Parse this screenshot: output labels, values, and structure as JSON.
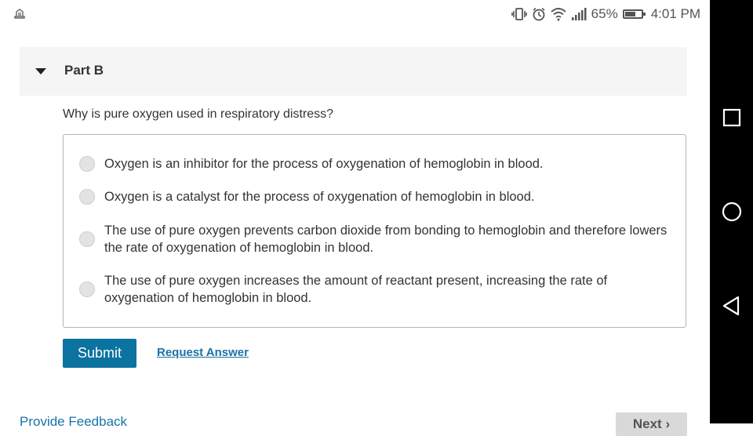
{
  "status_bar": {
    "battery_percent": "65%",
    "battery_level": 0.65,
    "time": "4:01 PM",
    "icons": [
      "vibrate-icon",
      "alarm-icon",
      "wifi-icon",
      "signal-icon",
      "battery-icon"
    ]
  },
  "part": {
    "title": "Part B"
  },
  "question": {
    "text": "Why is pure oxygen used in respiratory distress?",
    "options": [
      {
        "label": "Oxygen is an inhibitor for the process of oxygenation of hemoglobin in blood."
      },
      {
        "label": "Oxygen is a catalyst for the process of oxygenation of hemoglobin in blood."
      },
      {
        "label": "The use of pure oxygen prevents carbon dioxide from bonding to hemoglobin and therefore lowers the rate of oxygenation of hemoglobin in blood."
      },
      {
        "label": "The use of pure oxygen increases the amount of reactant present, increasing the rate of oxygenation of hemoglobin in blood."
      }
    ]
  },
  "actions": {
    "submit_label": "Submit",
    "request_answer_label": "Request Answer",
    "feedback_label": "Provide Feedback",
    "next_label": "Next"
  },
  "colors": {
    "accent": "#0b73a0",
    "link": "#1a73a8",
    "header_bg": "#f5f5f5"
  }
}
